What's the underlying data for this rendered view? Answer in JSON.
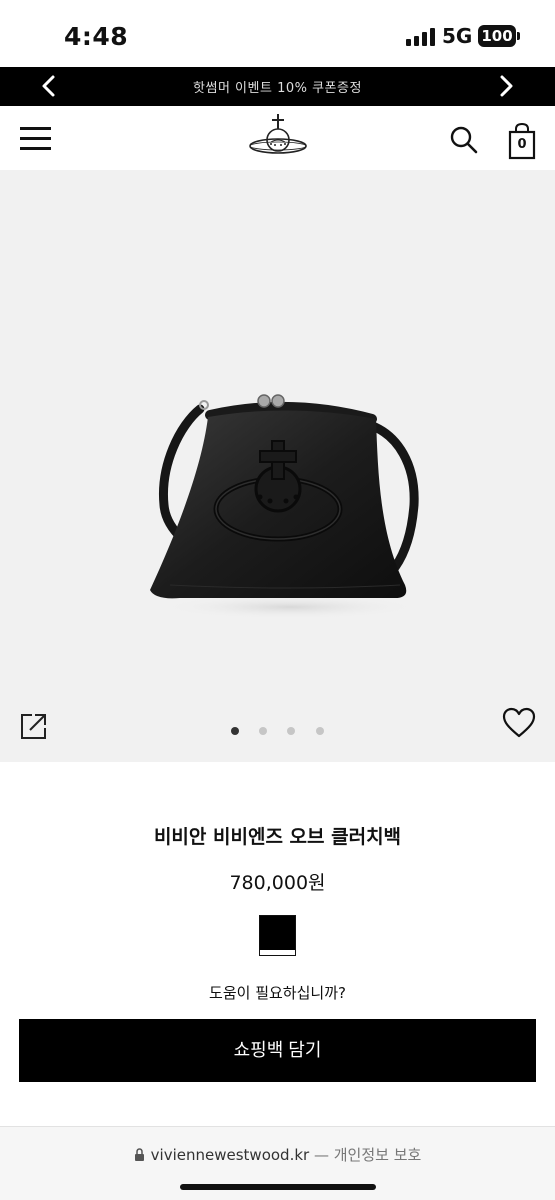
{
  "status_bar": {
    "time": "4:48",
    "network": "5G",
    "battery": "100"
  },
  "promo_banner": {
    "text": "핫썸머 이벤트 10% 쿠폰증정",
    "prev_icon": "chevron-left-icon",
    "next_icon": "chevron-right-icon"
  },
  "header": {
    "menu_icon": "hamburger-menu-icon",
    "logo_icon": "orb-logo-icon",
    "search_icon": "search-icon",
    "bag_icon": "shopping-bag-icon",
    "bag_count": "0"
  },
  "gallery": {
    "image_count": 4,
    "active_index": 0,
    "share_icon": "share-icon",
    "wishlist_icon": "heart-icon"
  },
  "product": {
    "name": "비비안 비비엔즈 오브 클러치백",
    "price": "780,000원",
    "color_swatch": "#000000",
    "help_text": "도움이 필요하십니까?",
    "add_to_bag_label": "쇼핑백 담기"
  },
  "browser": {
    "domain": "viviennewestwood.kr",
    "separator": " — ",
    "subtitle": "개인정보 보호"
  },
  "colors": {
    "banner_bg": "#000000",
    "hero_bg": "#f1f1f1",
    "button_bg": "#000000",
    "button_text": "#ffffff"
  }
}
